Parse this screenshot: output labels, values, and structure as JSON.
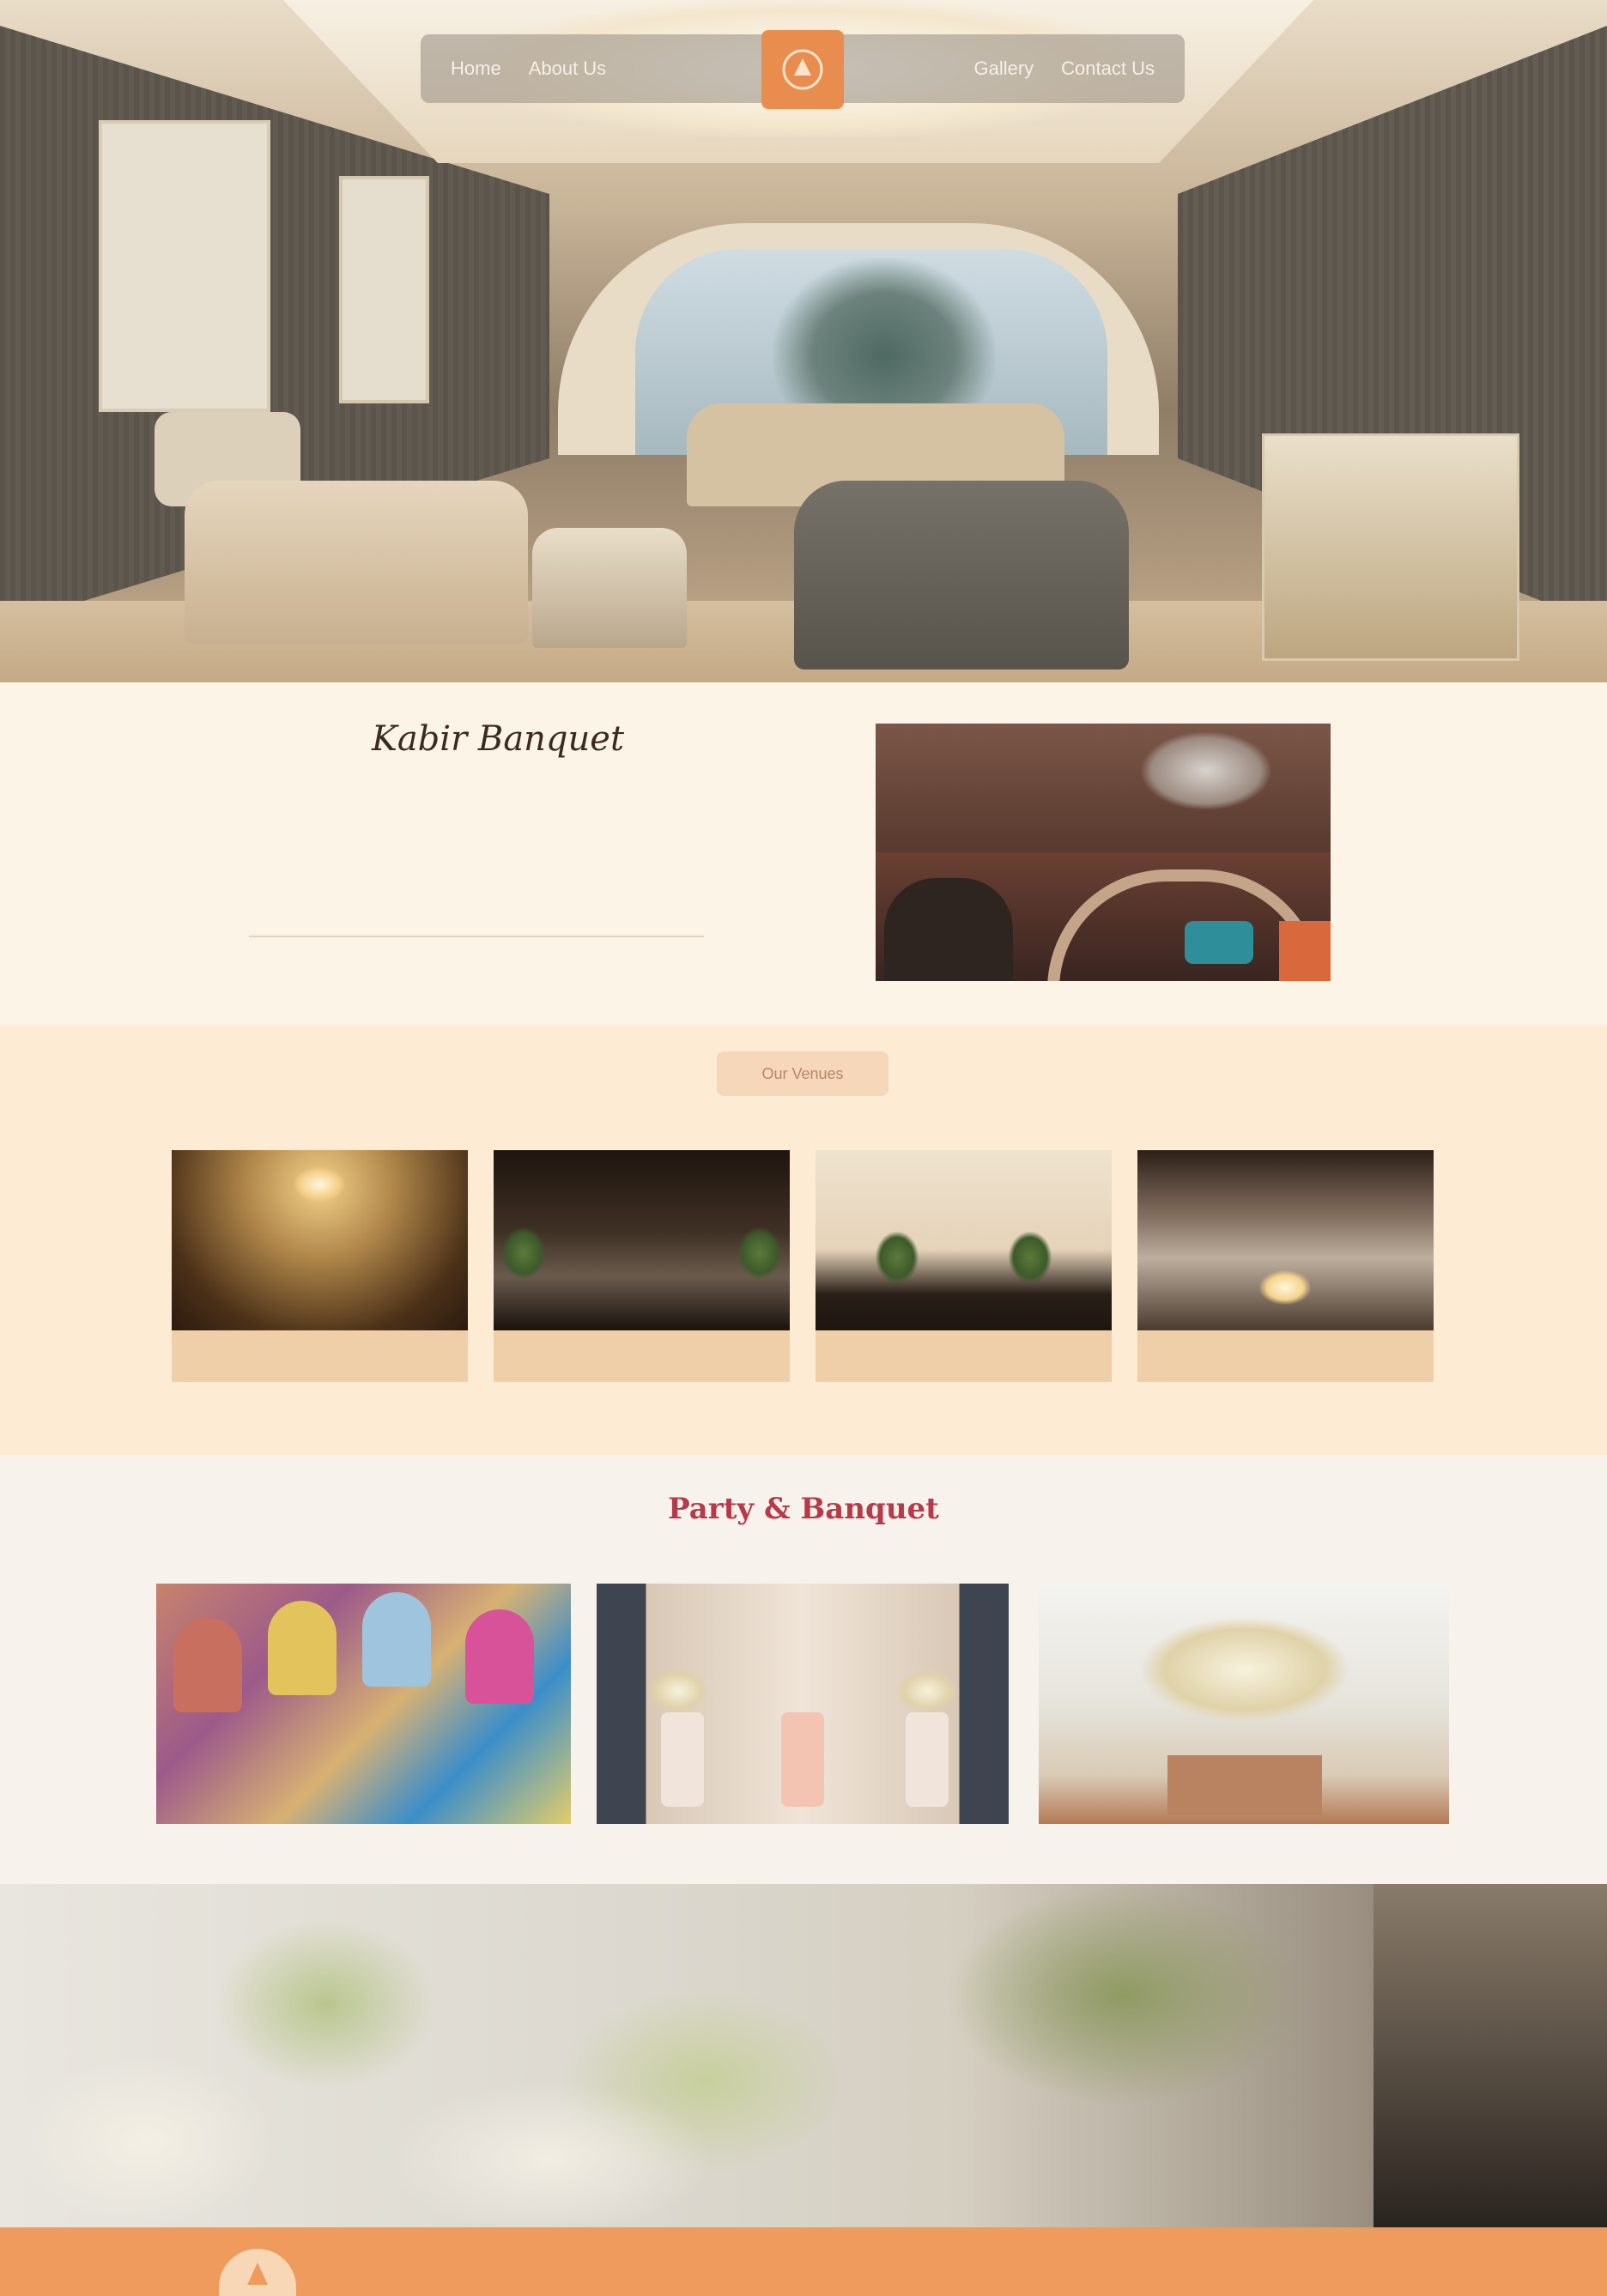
{
  "nav": {
    "left_links": [
      "Home",
      "About Us"
    ],
    "right_links": [
      "Gallery",
      "Contact Us"
    ]
  },
  "welcome": {
    "title": "Kabir Banquet",
    "subtitle": "",
    "body": ""
  },
  "venues": {
    "button_label": "Our Venues",
    "cards": [
      {
        "caption": ""
      },
      {
        "caption": ""
      },
      {
        "caption": ""
      },
      {
        "caption": ""
      }
    ]
  },
  "party": {
    "title": "Party & Banquet",
    "subtitle": ""
  },
  "footer": {
    "text": ""
  },
  "colors": {
    "accent": "#ee9b5d",
    "cream": "#fcf4e6",
    "title_red": "#b83a4a",
    "subtitle_orange": "#d8865c"
  }
}
